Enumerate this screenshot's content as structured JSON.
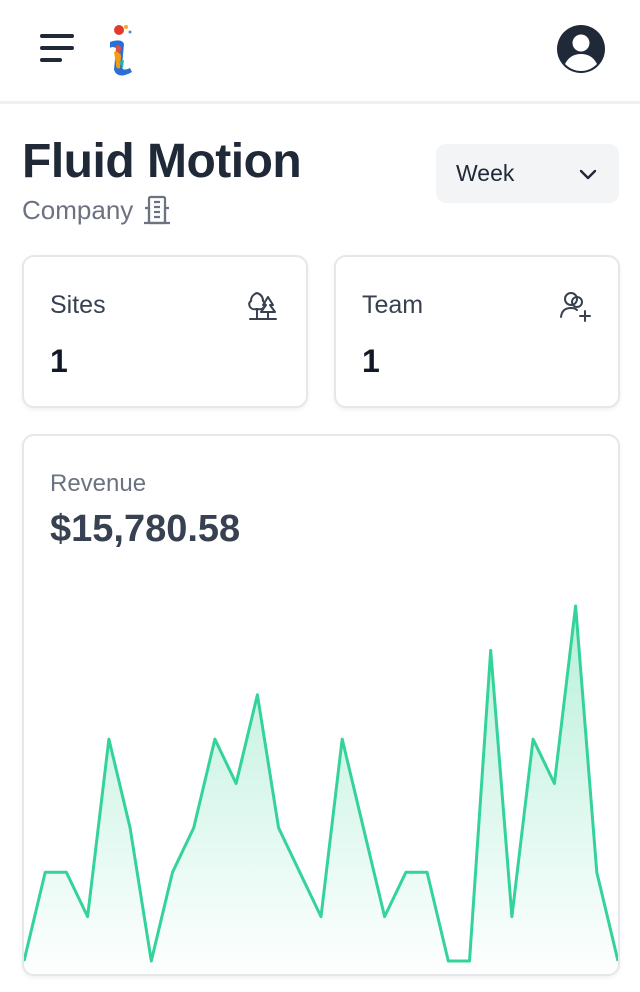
{
  "header": {
    "menu_icon": "hamburger-menu-icon",
    "logo_icon": "brand-letter-i-logo",
    "avatar_icon": "user-circle-icon"
  },
  "company": {
    "name": "Fluid Motion",
    "type": "Company",
    "type_icon": "building-icon"
  },
  "period": {
    "selected": "Week",
    "icon": "chevron-down-icon"
  },
  "stats": [
    {
      "label": "Sites",
      "value": "1",
      "icon": "trees-icon"
    },
    {
      "label": "Team",
      "value": "1",
      "icon": "user-plus-icon"
    }
  ],
  "revenue": {
    "label": "Revenue",
    "value": "$15,780.58"
  },
  "colors": {
    "accent": "#34d399",
    "text_dark": "#1f2937",
    "text_muted": "#6b7280",
    "select_bg": "#f3f4f6"
  },
  "chart_data": {
    "type": "area",
    "values": [
      0,
      2,
      2,
      1,
      5,
      3,
      0,
      2,
      3,
      5,
      4,
      6,
      3,
      2,
      1,
      5,
      3,
      1,
      2,
      2,
      0,
      0,
      7,
      1,
      5,
      4,
      8,
      2,
      0
    ],
    "ylim": [
      0,
      8
    ]
  }
}
